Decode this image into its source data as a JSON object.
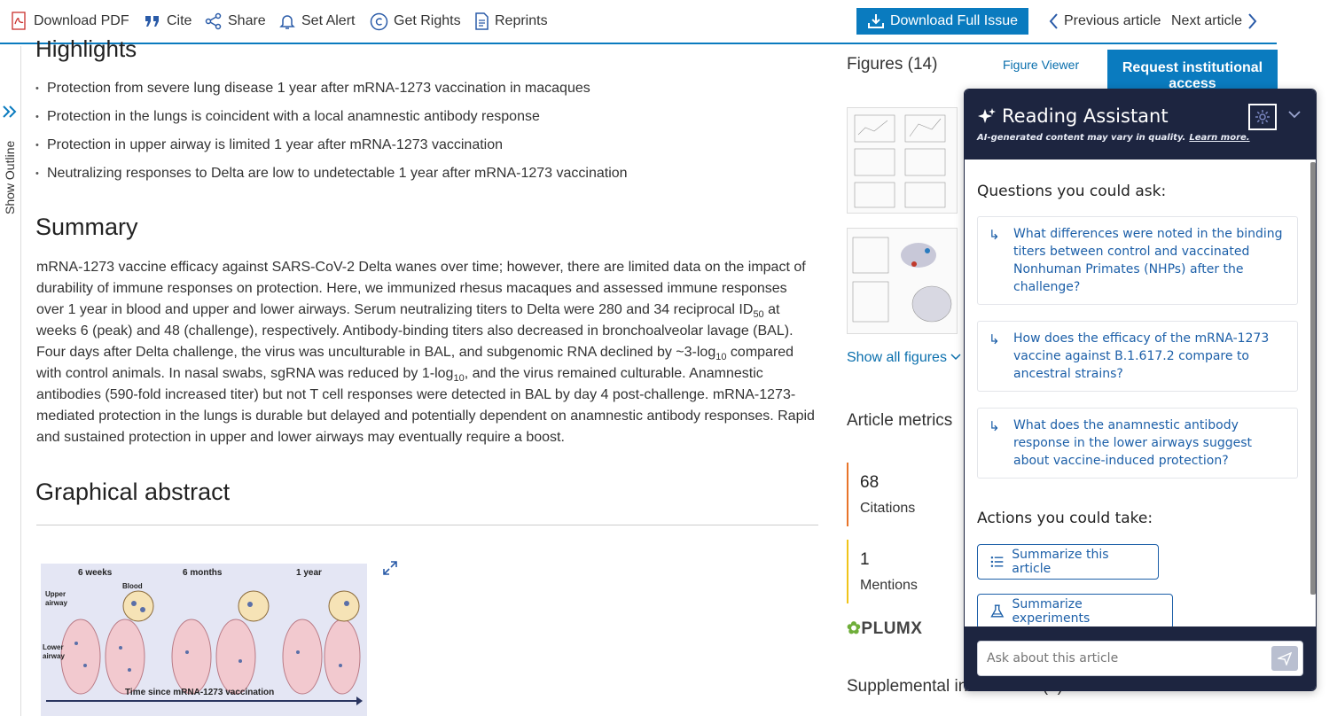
{
  "toolbar": {
    "download_pdf": "Download PDF",
    "cite": "Cite",
    "share": "Share",
    "set_alert": "Set Alert",
    "get_rights": "Get Rights",
    "reprints": "Reprints",
    "download_full_issue": "Download Full Issue",
    "previous_article": "Previous article",
    "next_article": "Next article"
  },
  "outline": {
    "label": "Show Outline",
    "icon": "double-chevron-right-icon"
  },
  "article": {
    "highlights_title": "Highlights",
    "highlights": [
      "Protection from severe lung disease 1 year after mRNA-1273 vaccination in macaques",
      "Protection in the lungs is coincident with a local anamnestic antibody response",
      "Protection in upper airway is limited 1 year after mRNA-1273 vaccination",
      "Neutralizing responses to Delta are low to undetectable 1 year after mRNA-1273 vaccination"
    ],
    "summary_title": "Summary",
    "summary_parts": {
      "p1": "mRNA-1273 vaccine efficacy against SARS-CoV-2 Delta wanes over time; however, there are limited data on the impact of durability of immune responses on protection. Here, we immunized rhesus macaques and assessed immune responses over 1 year in blood and upper and lower airways. Serum neutralizing titers to Delta were 280 and 34 reciprocal ID",
      "sub1": "50",
      "p2": " at weeks 6 (peak) and 48 (challenge), respectively. Antibody-binding titers also decreased in bronchoalveolar lavage (BAL). Four days after Delta challenge, the virus was unculturable in BAL, and subgenomic RNA declined by ~3-log",
      "sub2": "10",
      "p3": " compared with control animals. In nasal swabs, sgRNA was reduced by 1-log",
      "sub3": "10",
      "p4": ", and the virus remained culturable. Anamnestic antibodies (590-fold increased titer) but not T cell responses were detected in BAL by day 4 post-challenge. mRNA-1273-mediated protection in the lungs is durable but delayed and potentially dependent on anamnestic antibody responses. Rapid and sustained protection in upper and lower airways may eventually require a boost."
    },
    "graphical_abstract_title": "Graphical abstract",
    "graphical_abstract": {
      "time_labels": [
        "6 weeks",
        "6 months",
        "1 year"
      ],
      "region_labels": [
        "Upper airway",
        "Blood",
        "Lower airway"
      ],
      "axis_label": "Time since mRNA-1273 vaccination"
    }
  },
  "sidebar": {
    "figures_title": "Figures (14)",
    "figure_viewer": "Figure Viewer",
    "request_access": "Request institutional access",
    "show_all_figures": "Show all figures",
    "metrics_title": "Article metrics",
    "metrics": [
      {
        "value": "68",
        "label": "Citations",
        "color": "#e8742a"
      },
      {
        "value": "1",
        "label": "Mentions",
        "color": "#f0c419"
      }
    ],
    "plumx": "PLUMX",
    "supplemental_title": "Supplemental information (1)"
  },
  "reading_assistant": {
    "title": "Reading Assistant",
    "disclaimer": "AI-generated content may vary in quality.",
    "learn_more": "Learn more.",
    "questions_title": "Questions you could ask:",
    "questions": [
      "What differences were noted in the binding titers between control and vaccinated Nonhuman Primates (NHPs) after the challenge?",
      "How does the efficacy of the mRNA-1273 vaccine against B.1.617.2 compare to ancestral strains?",
      "What does the anamnestic antibody response in the lower airways suggest about vaccine-induced protection?"
    ],
    "actions_title": "Actions you could take:",
    "actions": [
      "Summarize this article",
      "Summarize experiments"
    ],
    "input_placeholder": "Ask about this article"
  },
  "colors": {
    "accent": "#0a7bbf",
    "panel_dark": "#1d2540",
    "link": "#1c5fa8"
  }
}
